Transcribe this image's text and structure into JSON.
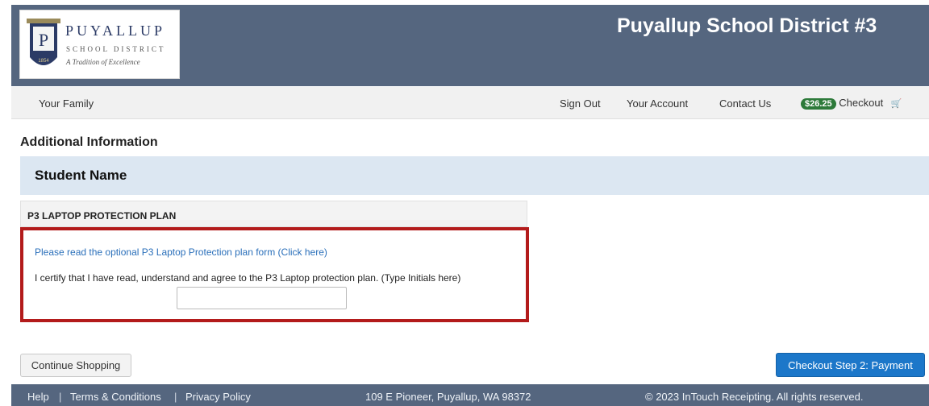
{
  "header": {
    "title": "Puyallup School District #3",
    "logo": {
      "name": "PUYALLUP",
      "subtitle": "SCHOOL DISTRICT",
      "tagline": "A Tradition of Excellence",
      "shield_letter": "P",
      "shield_year": "1854"
    }
  },
  "nav": {
    "your_family": "Your Family",
    "sign_out": "Sign Out",
    "your_account": "Your Account",
    "contact_us": "Contact Us",
    "cart_amount": "$26.25",
    "checkout": "Checkout"
  },
  "main": {
    "section_title": "Additional Information",
    "student_name": "Student Name",
    "panel_title": "P3 LAPTOP PROTECTION PLAN",
    "form_link": "Please read the optional P3 Laptop Protection plan form (Click here)",
    "certify_text": "I certify that I have read, understand and agree to the P3 Laptop protection plan. (Type Initials here)",
    "initials_value": ""
  },
  "buttons": {
    "continue_shopping": "Continue Shopping",
    "checkout_step2": "Checkout Step 2: Payment"
  },
  "footer": {
    "help": "Help",
    "separator": "|",
    "terms": "Terms & Conditions",
    "privacy": "Privacy Policy",
    "address": "109 E Pioneer, Puyallup, WA 98372",
    "copyright": "© 2023 InTouch Receipting. All rights reserved."
  },
  "colors": {
    "header_bg": "#55667f",
    "student_bar": "#dce7f2",
    "highlight_border": "#b31b1b",
    "primary_button": "#1c77c9",
    "cart_badge": "#2d7a3a",
    "link": "#2a6fba"
  }
}
